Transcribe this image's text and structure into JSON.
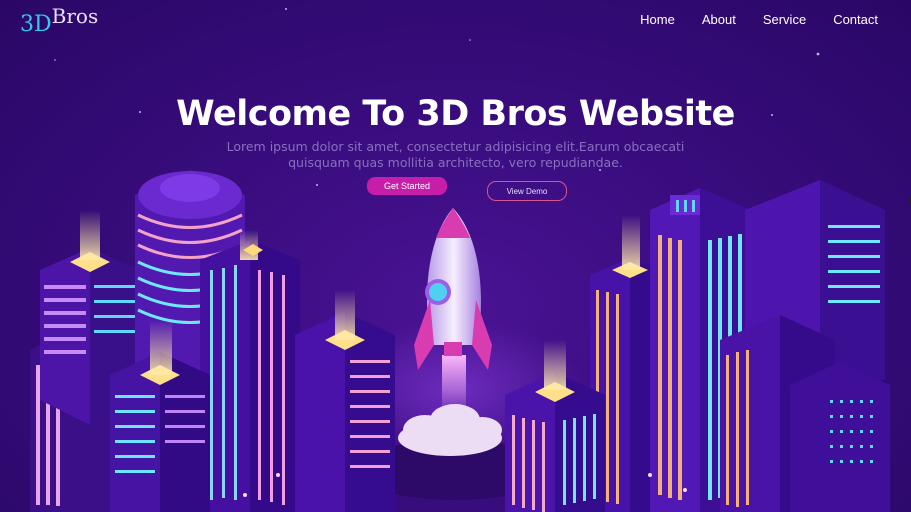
{
  "logo": {
    "part1": "3D",
    "part2": "Bros"
  },
  "nav": {
    "items": [
      "Home",
      "About",
      "Service",
      "Contact"
    ]
  },
  "hero": {
    "title": "Welcome To 3D Bros Website",
    "subtitle": "Lorem ipsum dolor sit amet, consectetur adipisicing elit.Earum obcaecati quisquam quas mollitia architecto, vero repudiandae.",
    "primary_button": "Get Started",
    "secondary_button": "View Demo"
  },
  "colors": {
    "background": "#3a0d80",
    "logo_accent": "#36c9f0",
    "primary_button": "#c61ea9",
    "outline_button_border": "#d9538f"
  }
}
